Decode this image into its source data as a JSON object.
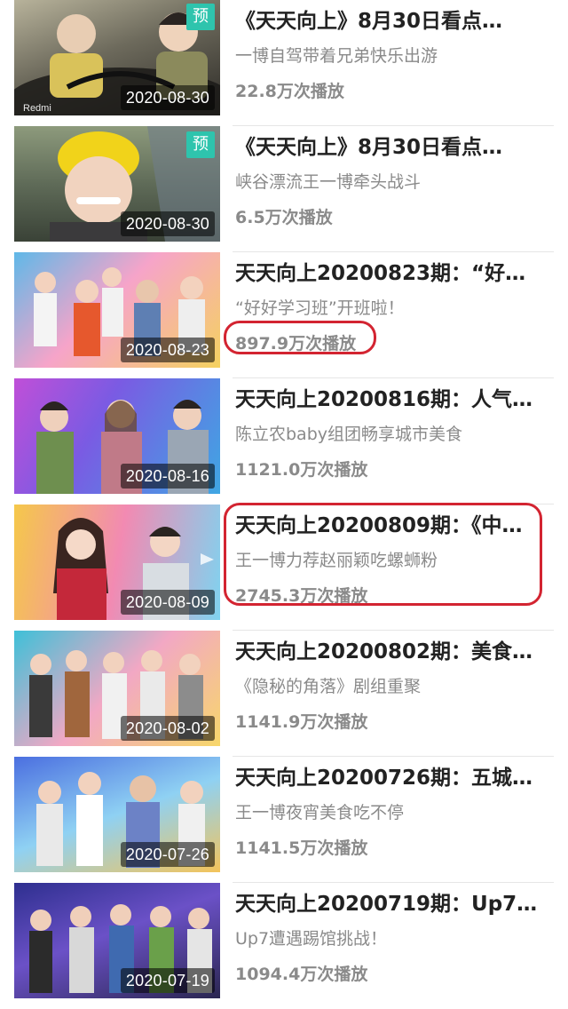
{
  "videos": [
    {
      "title": "《天天向上》8月30日看点…",
      "subtitle": "一博自驾带着兄弟快乐出游",
      "views": "22.8万次播放",
      "date": "2020-08-30",
      "badge": "预",
      "brand": "Redmi"
    },
    {
      "title": "《天天向上》8月30日看点…",
      "subtitle": "峡谷漂流王一博牵头战斗",
      "views": "6.5万次播放",
      "date": "2020-08-30",
      "badge": "预"
    },
    {
      "title": "天天向上20200823期：“好…",
      "subtitle": "“好好学习班”开班啦！",
      "views": "897.9万次播放",
      "date": "2020-08-23"
    },
    {
      "title": "天天向上20200816期：人气…",
      "subtitle": "陈立农baby组团畅享城市美食",
      "views": "1121.0万次播放",
      "date": "2020-08-16"
    },
    {
      "title": "天天向上20200809期：《中…",
      "subtitle": "王一博力荐赵丽颖吃螺蛳粉",
      "views": "2745.3万次播放",
      "date": "2020-08-09"
    },
    {
      "title": "天天向上20200802期：美食…",
      "subtitle": "《隐秘的角落》剧组重聚",
      "views": "1141.9万次播放",
      "date": "2020-08-02"
    },
    {
      "title": "天天向上20200726期：五城…",
      "subtitle": "王一博夜宵美食吃不停",
      "views": "1141.5万次播放",
      "date": "2020-07-26"
    },
    {
      "title": "天天向上20200719期：Up7…",
      "subtitle": "Up7遭遇踢馆挑战！",
      "views": "1094.4万次播放",
      "date": "2020-07-19"
    }
  ],
  "colors": {
    "highlight_ring": "#d32431",
    "badge": "#2ec4ad",
    "title": "#222222",
    "meta": "#8a8a8a"
  }
}
